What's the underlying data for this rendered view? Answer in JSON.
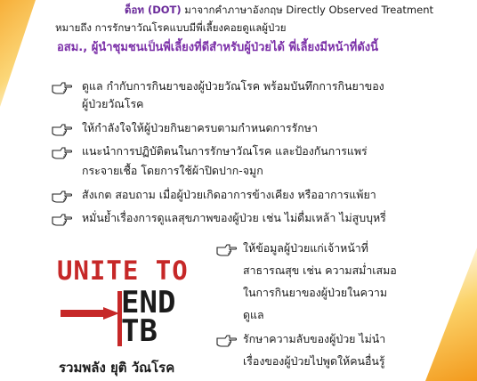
{
  "intro": {
    "dot_term": "ด็อท (DOT)",
    "dot_desc": "มาจากคำภาษาอังกฤษ Directly Observed Treatment",
    "meaning": "หมายถึง การรักษาวัณโรคแบบมีพี่เลี้ยงคอยดูแลผู้ป่วย"
  },
  "heading": "อสม., ผู้นำชุมชนเป็นพี่เลี้ยงที่ดีสำหรับผู้ป่วยได้ พี่เลี้ยงมีหน้าที่ดังนี้",
  "duties": [
    {
      "line1": "ดูแล กำกับการกินยาของผู้ป่วยวัณโรค พร้อมบันทึกการกินยาของ",
      "line2": "ผู้ป่วยวัณโรค"
    },
    {
      "line1": "ให้กำลังใจให้ผู้ป่วยกินยาครบตามกำหนดการรักษา"
    },
    {
      "line1": "แนะนำการปฏิบัติตนในการรักษาวัณโรค และป้องกันการแพร่",
      "line2": "กระจายเชื้อ โดยการใช้ผ้าปิดปาก-จมูก"
    },
    {
      "line1": "สังเกต สอบถาม เมื่อผู้ป่วยเกิดอาการข้างเคียง หรืออาการแพ้ยา"
    },
    {
      "line1": "หมั่นย้ำเรื่องการดูแลสุขภาพของผู้ป่วย เช่น ไม่ดื่มเหล้า ไม่สูบบุหรี่"
    }
  ],
  "right_duties": [
    {
      "lines": [
        "ให้ข้อมูลผู้ป่วยแก่เจ้าหน้าที่",
        "สาธารณสุข เช่น ความสม่ำเสมอ",
        "ในการกินยาของผู้ป่วยในความ",
        "ดูแล"
      ]
    },
    {
      "lines": [
        "รักษาความลับของผู้ป่วย ไม่นำ",
        "เรื่องของผู้ป่วยไปพูดให้คนอื่นรู้"
      ]
    }
  ],
  "logo": {
    "line1": "UNITE TO",
    "line2": "END",
    "line3": "TB"
  },
  "caption": "รวมพลัง ยุติ วัณโรค",
  "colors": {
    "purple": "#7b2fa8",
    "logo_red": "#c62828",
    "accent": "#f6a623"
  },
  "icon": "pointing-hand-icon"
}
